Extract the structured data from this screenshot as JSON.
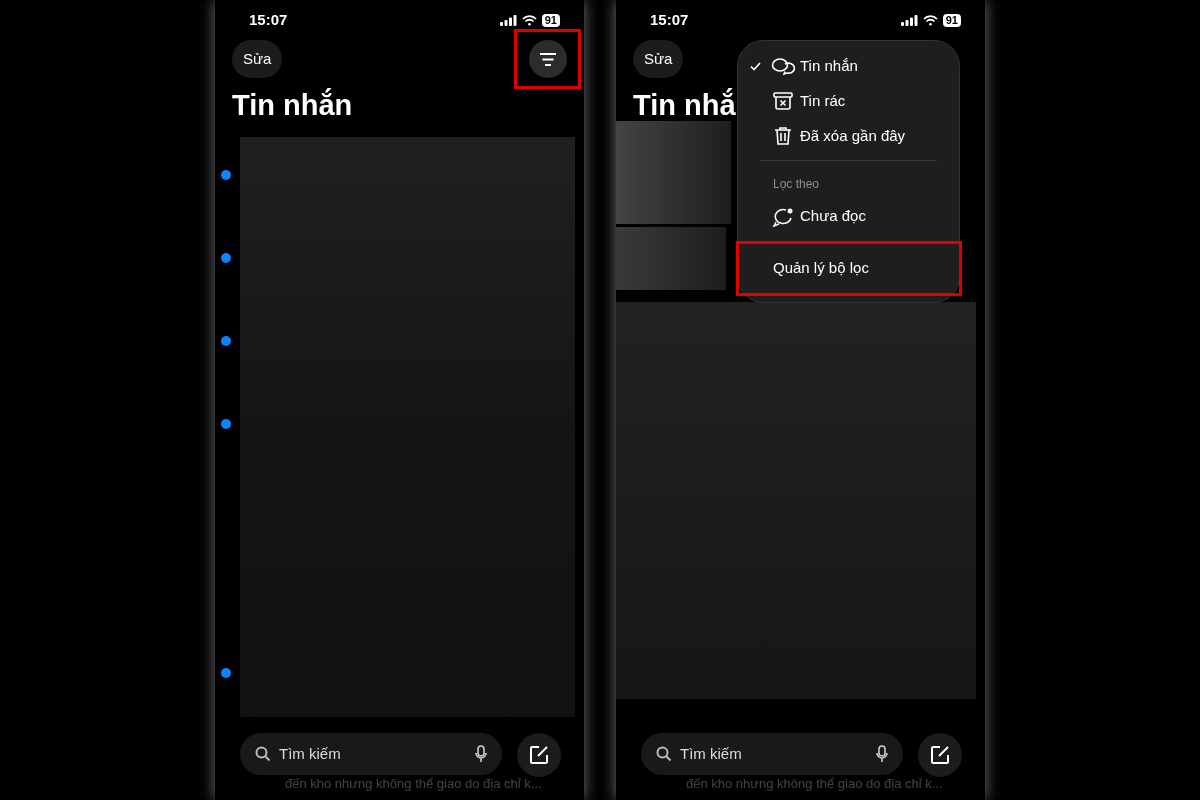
{
  "screens": [
    {
      "status_bar": {
        "time": "15:07",
        "battery": "91"
      },
      "edit_button": "Sửa",
      "filter_button": {
        "highlighted": true
      },
      "title": "Tin nhắn",
      "conversations": [
        {
          "unread": true
        },
        {
          "unread": true
        },
        {
          "unread": true
        },
        {
          "unread": true
        },
        {
          "unread": false
        },
        {
          "unread": false
        },
        {
          "unread": true
        }
      ],
      "search": {
        "placeholder": "Tìm kiếm"
      },
      "preview_text": "đến kho nhưng không thể giao do địa chỉ k..."
    },
    {
      "status_bar": {
        "time": "15:07",
        "battery": "91"
      },
      "edit_button": "Sửa",
      "title": "Tin nhắ",
      "menu": {
        "items": [
          {
            "kind": "option",
            "label": "Tin nhắn",
            "checked": true,
            "highlighted": false
          },
          {
            "kind": "option",
            "label": "Tin rác",
            "checked": false,
            "highlighted": false
          },
          {
            "kind": "option",
            "label": "Đã xóa gần đây",
            "checked": false,
            "highlighted": false
          },
          {
            "kind": "header",
            "label": "Lọc theo"
          },
          {
            "kind": "option",
            "label": "Chưa đọc",
            "checked": false,
            "highlighted": false
          },
          {
            "kind": "action",
            "label": "Quản lý bộ lọc",
            "highlighted": true
          }
        ]
      },
      "search": {
        "placeholder": "Tìm kiếm"
      },
      "preview_text": "đến kho nhưng không thể giao do địa chỉ k..."
    }
  ]
}
